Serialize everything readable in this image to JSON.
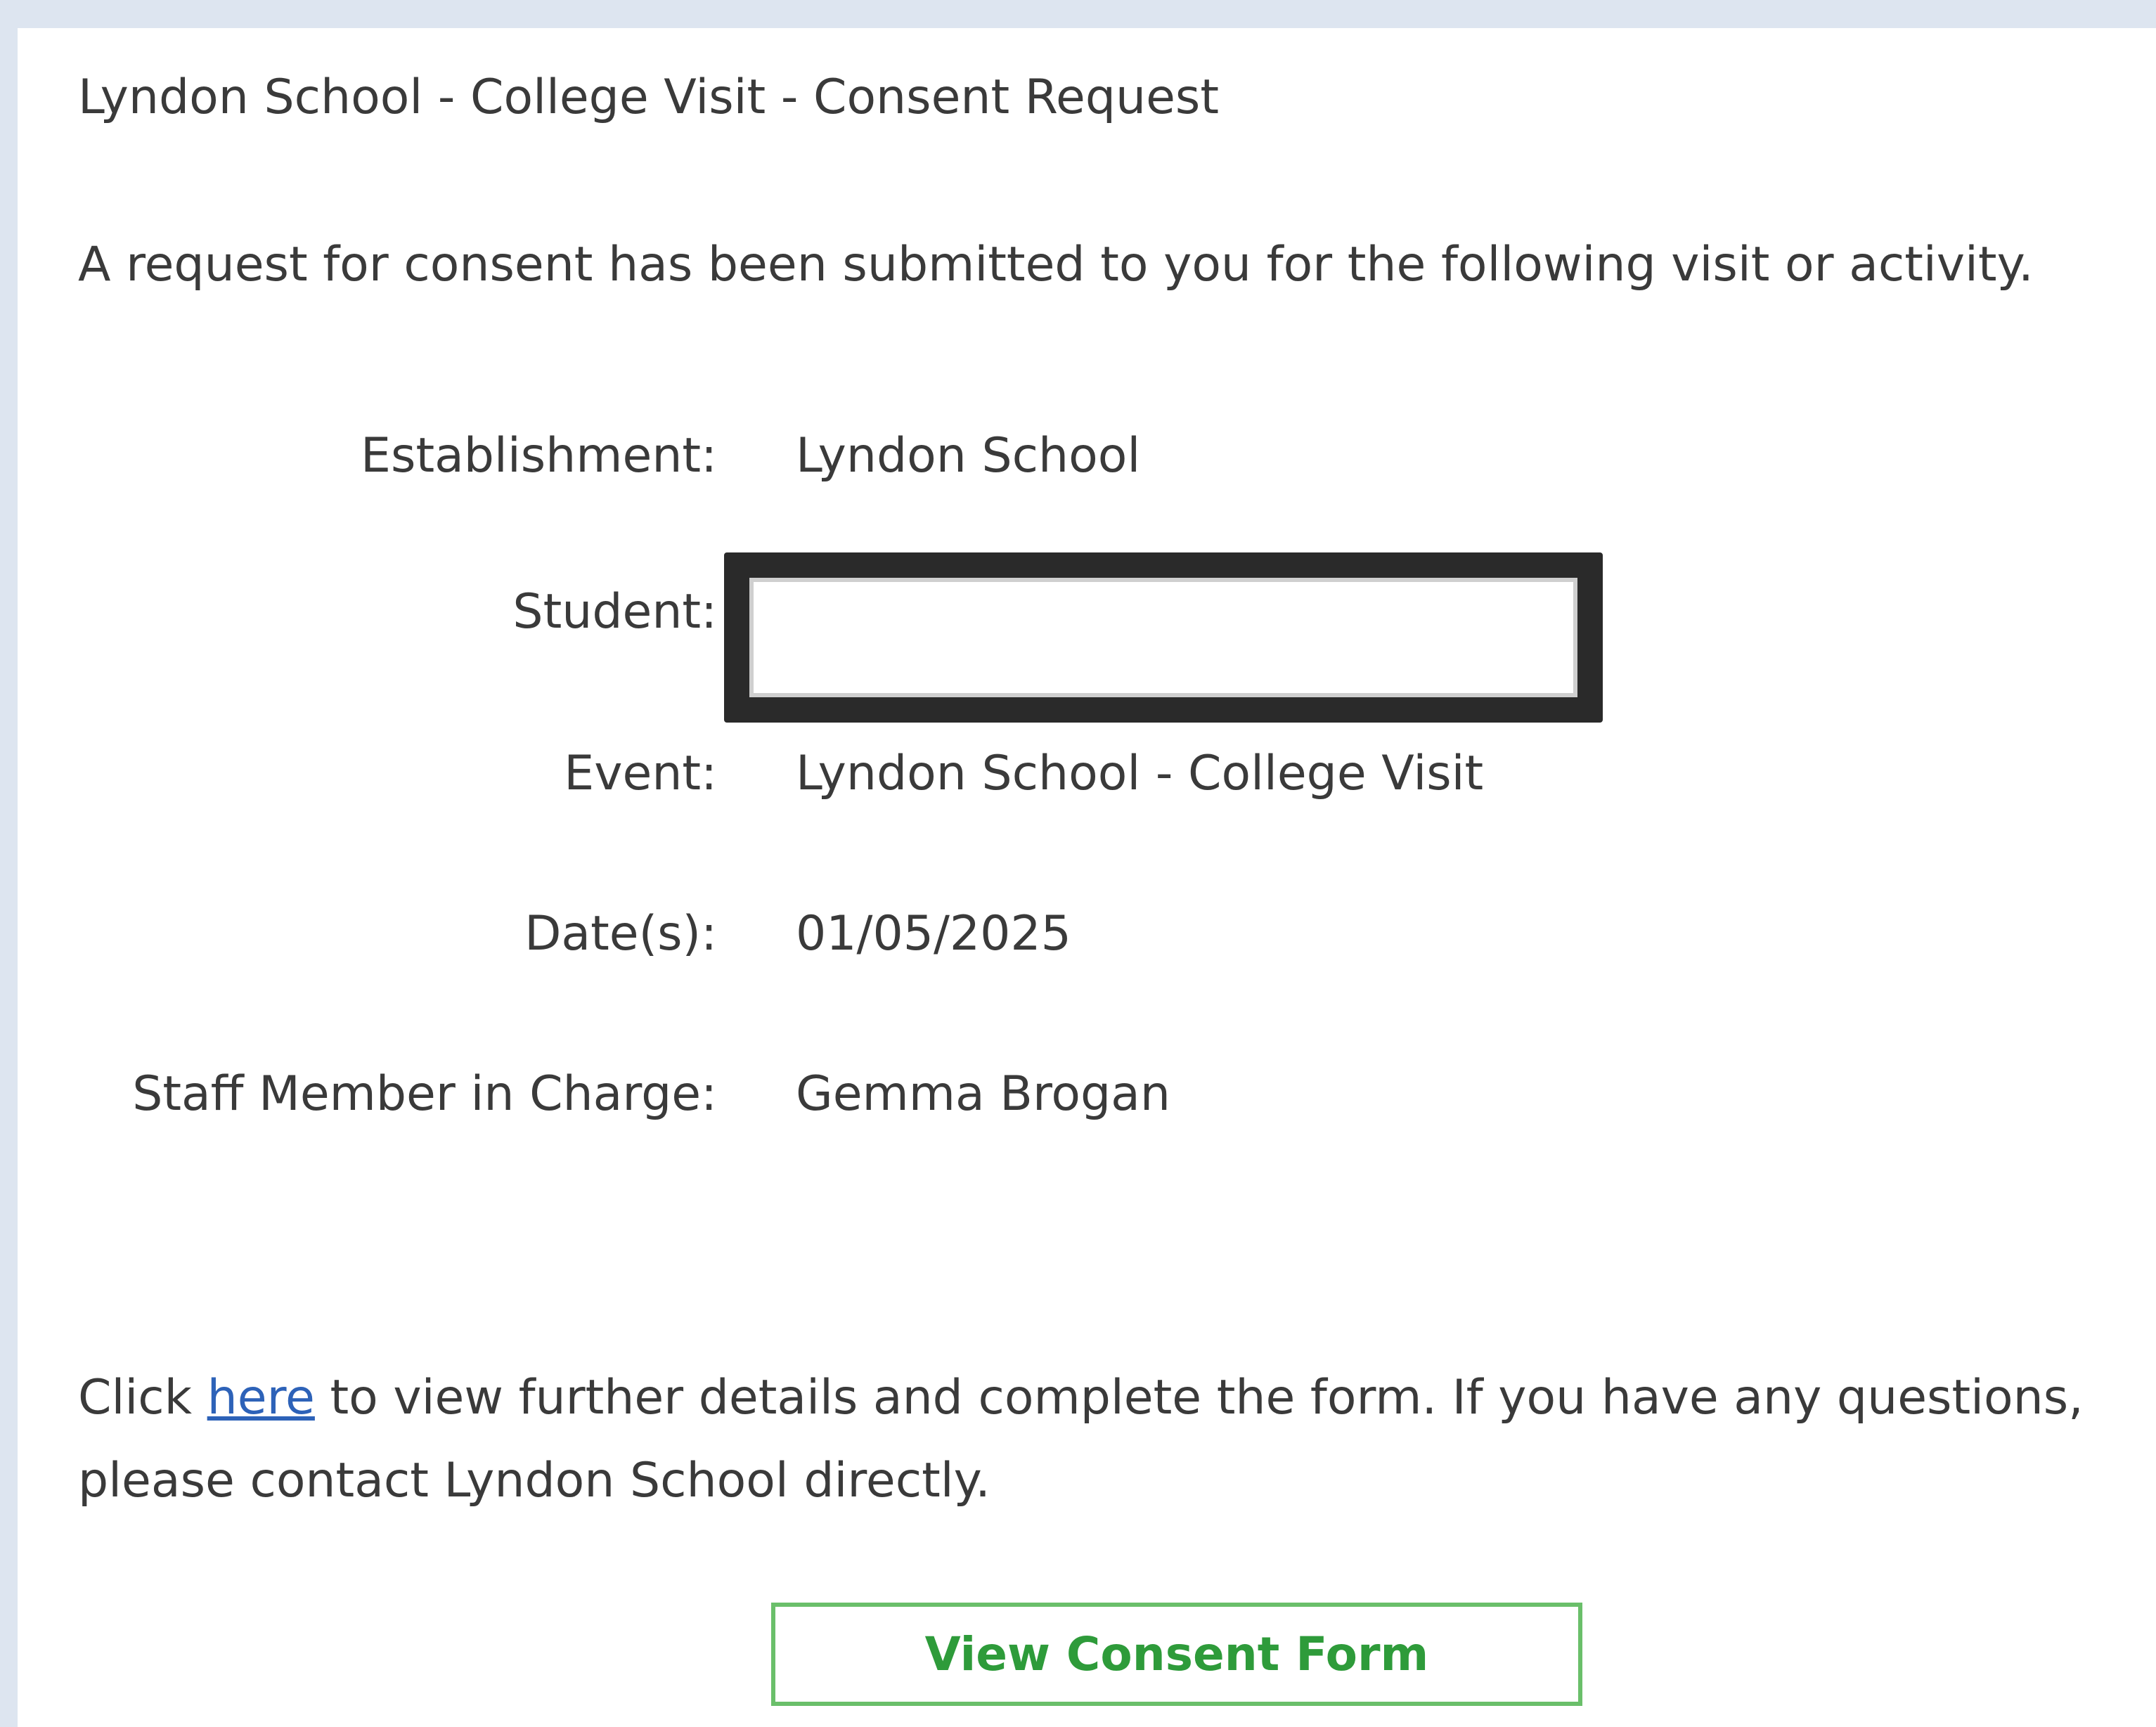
{
  "email": {
    "subject": "Lyndon School - College Visit - Consent Request",
    "intro": "A request for consent has been submitted to you for the following visit or activity.",
    "details": {
      "establishment": {
        "label": "Establishment:",
        "value": "Lyndon School"
      },
      "student": {
        "label": "Student:",
        "value": ""
      },
      "event": {
        "label": "Event:",
        "value": "Lyndon School - College Visit"
      },
      "dates": {
        "label": "Date(s):",
        "value": "01/05/2025"
      },
      "staff": {
        "label": "Staff Member in Charge:",
        "value": "Gemma Brogan"
      }
    },
    "footer": {
      "prefix": "Click ",
      "link_text": "here",
      "suffix": " to view further details and complete the form. If you have any questions, please contact Lyndon School directly."
    },
    "button_label": "View Consent Form"
  },
  "colors": {
    "page_background": "#dde5f0",
    "link": "#2d62b8",
    "button_border": "#6abf6a",
    "button_text": "#2e9b3a"
  }
}
